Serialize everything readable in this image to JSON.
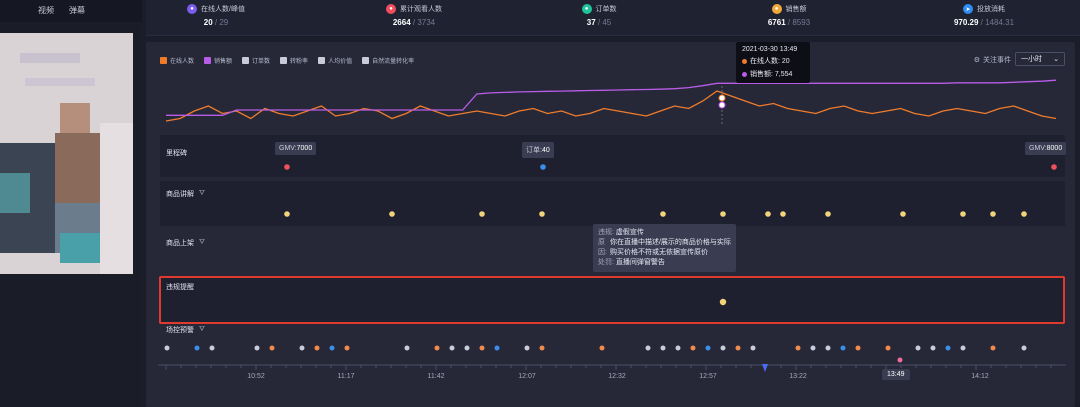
{
  "left_tabs": [
    "视频",
    "弹幕"
  ],
  "stats": [
    {
      "label": "在线人数/峰值",
      "value": "20",
      "total": "29",
      "icon": "user-icon",
      "color": "#7b5cf0"
    },
    {
      "label": "累计观看人数",
      "value": "2664",
      "total": "3734",
      "icon": "eye-icon",
      "color": "#f04e5e"
    },
    {
      "label": "订单数",
      "value": "37",
      "total": "45",
      "icon": "order-icon",
      "color": "#21c49a"
    },
    {
      "label": "销售额",
      "value": "6761",
      "total": "8593",
      "icon": "coin-icon",
      "color": "#f2a93b"
    },
    {
      "label": "投放消耗",
      "value": "970.29",
      "total": "1484.31",
      "icon": "send-icon",
      "color": "#2f8cf0"
    }
  ],
  "legend": [
    {
      "label": "在线人数",
      "color": "#f07c2b",
      "active": true
    },
    {
      "label": "销售额",
      "color": "#b95ce8",
      "active": true
    },
    {
      "label": "订单数",
      "color": "#c9cbd8",
      "active": false
    },
    {
      "label": "转粉率",
      "color": "#c9cbd8",
      "active": false
    },
    {
      "label": "人均价值",
      "color": "#c9cbd8",
      "active": false
    },
    {
      "label": "自然流量转化率",
      "color": "#c9cbd8",
      "active": false
    }
  ],
  "follow_event_label": "关注事件",
  "interval_select": "一小时",
  "chart_data": {
    "type": "line",
    "series": [
      {
        "name": "在线人数",
        "color": "#f07c2b",
        "values": [
          12,
          13,
          16,
          18,
          15,
          16,
          13,
          17,
          15,
          14,
          16,
          18,
          14,
          15,
          17,
          16,
          13,
          15,
          18,
          16,
          14,
          15,
          16,
          15,
          14,
          16,
          17,
          15,
          16,
          14,
          15,
          17,
          16,
          15,
          14,
          16,
          18,
          17,
          20,
          24,
          22,
          20,
          18,
          19,
          17,
          16,
          15,
          17,
          18,
          16,
          15,
          16,
          17,
          15,
          14,
          16,
          17,
          16,
          15,
          17,
          18,
          16,
          14,
          13
        ]
      },
      {
        "name": "销售额",
        "color": "#b95ce8",
        "values": [
          2000,
          2000,
          2000,
          2000,
          2000,
          3000,
          3000,
          3000,
          3000,
          3000,
          3000,
          3000,
          3000,
          3000,
          3000,
          3000,
          3000,
          3000,
          3000,
          3000,
          3000,
          3000,
          6000,
          6200,
          6300,
          6400,
          6450,
          6500,
          6550,
          6600,
          6650,
          6700,
          6750,
          6800,
          6850,
          6900,
          7000,
          7200,
          7554,
          8000,
          8000,
          8000,
          8000,
          8000,
          8000,
          8000,
          8000,
          8000,
          8000,
          8000,
          8000,
          8000,
          8000,
          8000,
          8000,
          8000,
          8100,
          8100,
          8100,
          8100,
          8200,
          8300,
          8400,
          8593
        ]
      }
    ]
  },
  "tooltip_top": {
    "time": "2021-03-30 13:49",
    "rows": [
      {
        "label": "在线人数: 20",
        "color": "#f07c2b"
      },
      {
        "label": "销售额: 7,554",
        "color": "#b95ce8"
      }
    ]
  },
  "rows": {
    "milestone": "里程碑",
    "product_explain": "商品讲解",
    "product_listing": "商品上架",
    "violation": "违规提醒",
    "control": "场控预警"
  },
  "milestones": [
    {
      "key": "GMV",
      "val": "7000"
    },
    {
      "key": "订单",
      "val": "40"
    },
    {
      "key": "GMV",
      "val": "8000"
    }
  ],
  "tooltip_violation": {
    "k1": "违规:",
    "v1": "虚假宣传",
    "k2": "原因:",
    "v2": "你在直播中描述/展示的商品价格与实际购买价格不符或无依据宣传原价",
    "k3": "处罚:",
    "v3": "直播间弹窗警告"
  },
  "timeline_ticks": [
    "10:52",
    "11:17",
    "11:42",
    "12:07",
    "12:32",
    "12:57",
    "13:22",
    "13:49",
    "14:12"
  ],
  "current_time": "13:49"
}
